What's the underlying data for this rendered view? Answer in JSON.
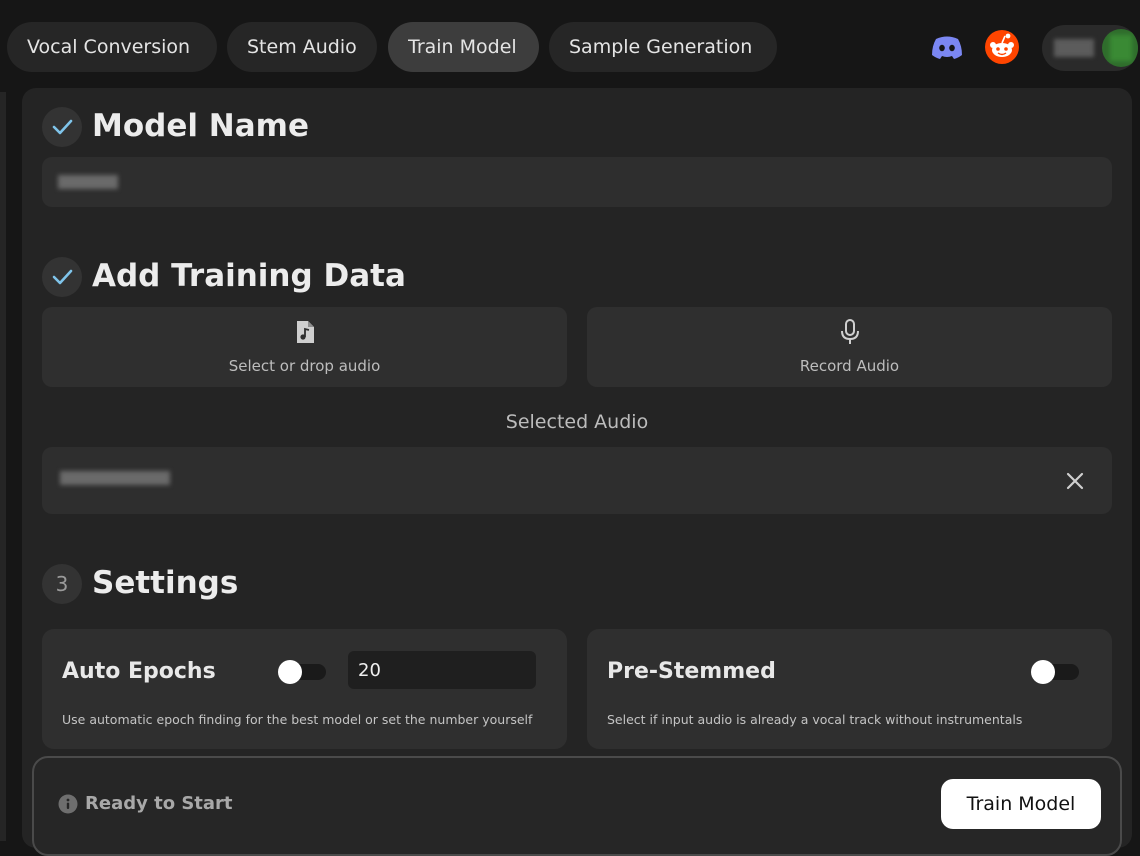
{
  "tabs": [
    {
      "label": "Vocal Conversion",
      "active": false
    },
    {
      "label": "Stem Audio",
      "active": false
    },
    {
      "label": "Train Model",
      "active": true
    },
    {
      "label": "Sample Generation",
      "active": false
    }
  ],
  "header": {
    "icons": [
      "discord-icon",
      "reddit-icon"
    ],
    "colors": {
      "discord": "#7b87f2",
      "reddit": "#ff4500"
    }
  },
  "steps": {
    "model_name": {
      "title": "Model Name",
      "status": "complete",
      "value": ""
    },
    "training_data": {
      "title": "Add Training Data",
      "status": "complete",
      "select_label": "Select or drop audio",
      "record_label": "Record Audio",
      "selected_heading": "Selected Audio",
      "selected_file": ""
    },
    "settings": {
      "number": "3",
      "title": "Settings",
      "auto_epochs": {
        "title": "Auto Epochs",
        "enabled": false,
        "value": "20",
        "description": "Use automatic epoch finding for the best model or set the number yourself"
      },
      "pre_stemmed": {
        "title": "Pre-Stemmed",
        "enabled": false,
        "description": "Select if input audio is already a vocal track without instrumentals"
      }
    }
  },
  "footer": {
    "status": "Ready to Start",
    "button": "Train Model"
  },
  "colors": {
    "background": "#161616",
    "panel": "#242424",
    "checkmark": "#7fc4ea",
    "primary_button": "#ffffff"
  }
}
